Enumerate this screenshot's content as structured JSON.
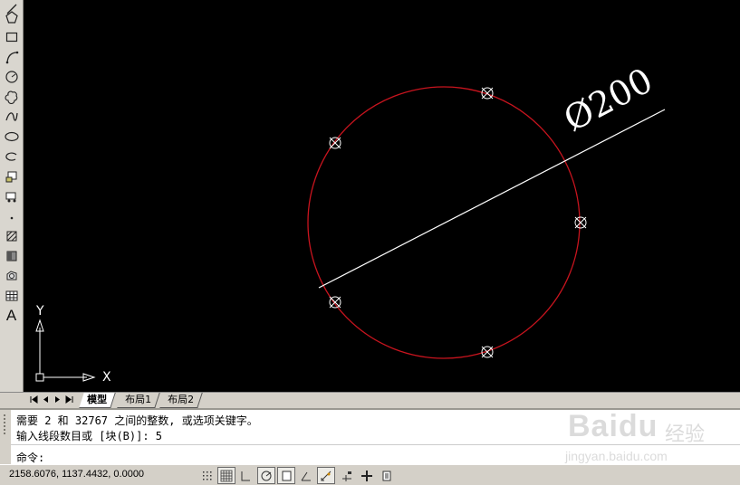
{
  "toolbar": {
    "tools": [
      "polygon-icon",
      "rectangle-icon",
      "arc-icon",
      "circle-icon",
      "revision-cloud-icon",
      "spline-icon",
      "ellipse-icon",
      "ellipse-arc-icon",
      "insert-block-icon",
      "make-block-icon",
      "point-icon",
      "hatch-icon",
      "gradient-icon",
      "region-icon",
      "table-icon",
      "multiline-text-icon"
    ],
    "text_tool_glyph": "A"
  },
  "drawing": {
    "dimension_text": "Ø200",
    "colors": {
      "circle": "#c8141e",
      "dimension": "#ffffff",
      "markers": "#ffffff",
      "background": "#000000"
    },
    "ucs": {
      "x_label": "X",
      "y_label": "Y"
    }
  },
  "layout_tabs": [
    "模型",
    "布局1",
    "布局2"
  ],
  "command": {
    "history": [
      "需要 2 和 32767 之间的整数, 或选项关键字。",
      "输入线段数目或 [块(B)]: 5"
    ],
    "prompt": "命令:"
  },
  "status": {
    "coordinates": "2158.6076, 1137.4432, 0.0000",
    "toggles": [
      "snap-icon",
      "grid-icon",
      "ortho-icon",
      "polar-icon",
      "object-snap-icon",
      "object-track-icon",
      "ducs-icon",
      "dynamic-input-icon",
      "lineweight-icon",
      "quick-properties-icon"
    ]
  },
  "watermark": {
    "brand": "Baidu",
    "label": "经验",
    "url": "jingyan.baidu.com"
  }
}
